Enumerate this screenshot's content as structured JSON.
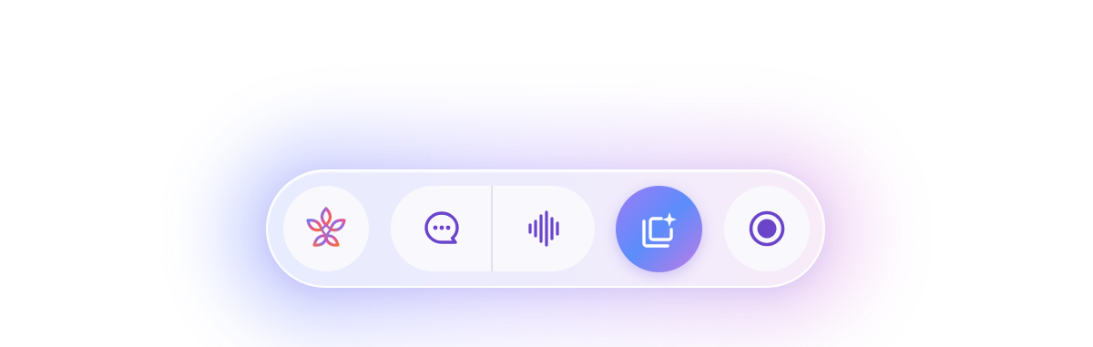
{
  "toolbar": {
    "buttons": [
      {
        "id": "logo",
        "icon": "knot-logo-icon"
      },
      {
        "id": "chat",
        "icon": "chat-bubble-icon"
      },
      {
        "id": "voice",
        "icon": "audio-waveform-icon"
      },
      {
        "id": "capture",
        "icon": "sparkle-copy-icon"
      },
      {
        "id": "record",
        "icon": "record-icon"
      }
    ]
  },
  "colors": {
    "accent_purple": "#6a45c9",
    "gradient_start": "#5b8dfb",
    "gradient_end": "#c179e6",
    "logo_pink": "#e9528f",
    "logo_blue": "#6b7cf4",
    "logo_orange": "#f0763d",
    "button_bg": "#f9f8fd"
  }
}
